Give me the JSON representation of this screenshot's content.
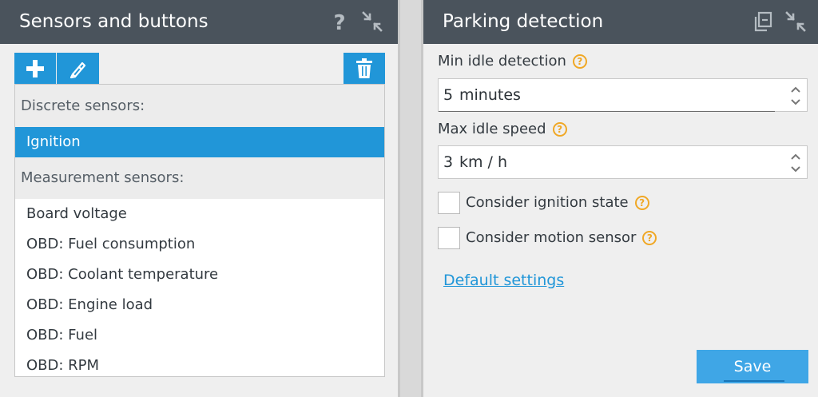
{
  "left_panel": {
    "title": "Sensors and buttons",
    "header_icons": [
      "help-icon",
      "collapse-icon"
    ],
    "toolbar": {
      "add_icon": "plus-icon",
      "edit_icon": "edit-icon",
      "delete_icon": "trash-icon"
    },
    "list": {
      "discrete_group": "Discrete sensors:",
      "discrete_items": [
        "Ignition"
      ],
      "selected_item": "Ignition",
      "measurement_group": "Measurement sensors:",
      "measurement_items": [
        "Board voltage",
        "OBD: Fuel consumption",
        "OBD: Coolant temperature",
        "OBD: Engine load",
        "OBD: Fuel",
        "OBD: RPM"
      ]
    }
  },
  "right_panel": {
    "title": "Parking detection",
    "header_icons": [
      "copy-icon",
      "collapse-icon"
    ],
    "min_idle": {
      "label": "Min idle detection",
      "value": "5",
      "unit": "minutes"
    },
    "max_speed": {
      "label": "Max idle speed",
      "value": "3",
      "unit": "km / h"
    },
    "ignition_checkbox": {
      "label": "Consider ignition state",
      "checked": false
    },
    "motion_checkbox": {
      "label": "Consider motion sensor",
      "checked": false
    },
    "default_link": "Default settings",
    "save_label": "Save"
  },
  "colors": {
    "header_bg": "#4a535c",
    "accent": "#2196d8",
    "help": "#f0a826",
    "save": "#3fa6e6"
  }
}
